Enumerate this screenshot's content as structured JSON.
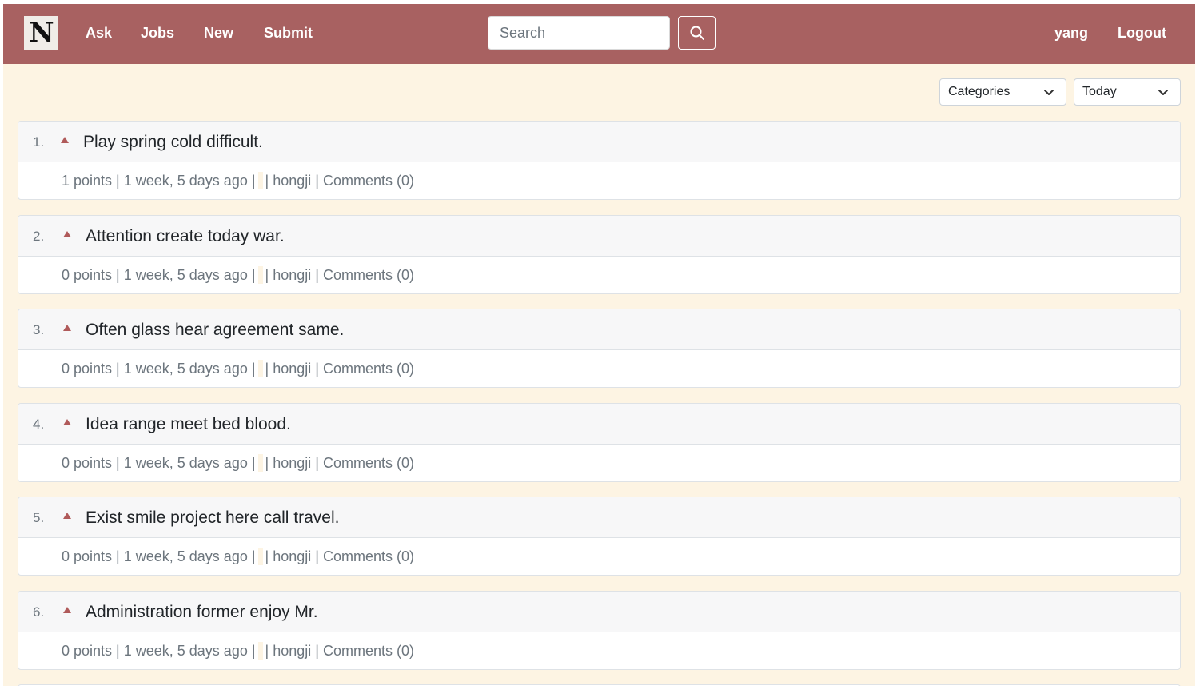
{
  "nav": {
    "logo": "N",
    "links": [
      "Ask",
      "Jobs",
      "New",
      "Submit"
    ],
    "search_placeholder": "Search",
    "user": "yang",
    "logout": "Logout"
  },
  "filters": {
    "categories": "Categories",
    "period": "Today"
  },
  "stories": [
    {
      "rank": "1.",
      "title": "Play spring cold difficult.",
      "points": "1 points",
      "age": "1 week, 5 days ago",
      "author": "hongji",
      "comments": "Comments (0)"
    },
    {
      "rank": "2.",
      "title": "Attention create today war.",
      "points": "0 points",
      "age": "1 week, 5 days ago",
      "author": "hongji",
      "comments": "Comments (0)"
    },
    {
      "rank": "3.",
      "title": "Often glass hear agreement same.",
      "points": "0 points",
      "age": "1 week, 5 days ago",
      "author": "hongji",
      "comments": "Comments (0)"
    },
    {
      "rank": "4.",
      "title": "Idea range meet bed blood.",
      "points": "0 points",
      "age": "1 week, 5 days ago",
      "author": "hongji",
      "comments": "Comments (0)"
    },
    {
      "rank": "5.",
      "title": "Exist smile project here call travel.",
      "points": "0 points",
      "age": "1 week, 5 days ago",
      "author": "hongji",
      "comments": "Comments (0)"
    },
    {
      "rank": "6.",
      "title": "Administration former enjoy Mr.",
      "points": "0 points",
      "age": "1 week, 5 days ago",
      "author": "hongji",
      "comments": "Comments (0)"
    }
  ],
  "colors": {
    "navbar": "#a86161",
    "background": "#fdf4e3",
    "upvote": "#b05a5a"
  }
}
